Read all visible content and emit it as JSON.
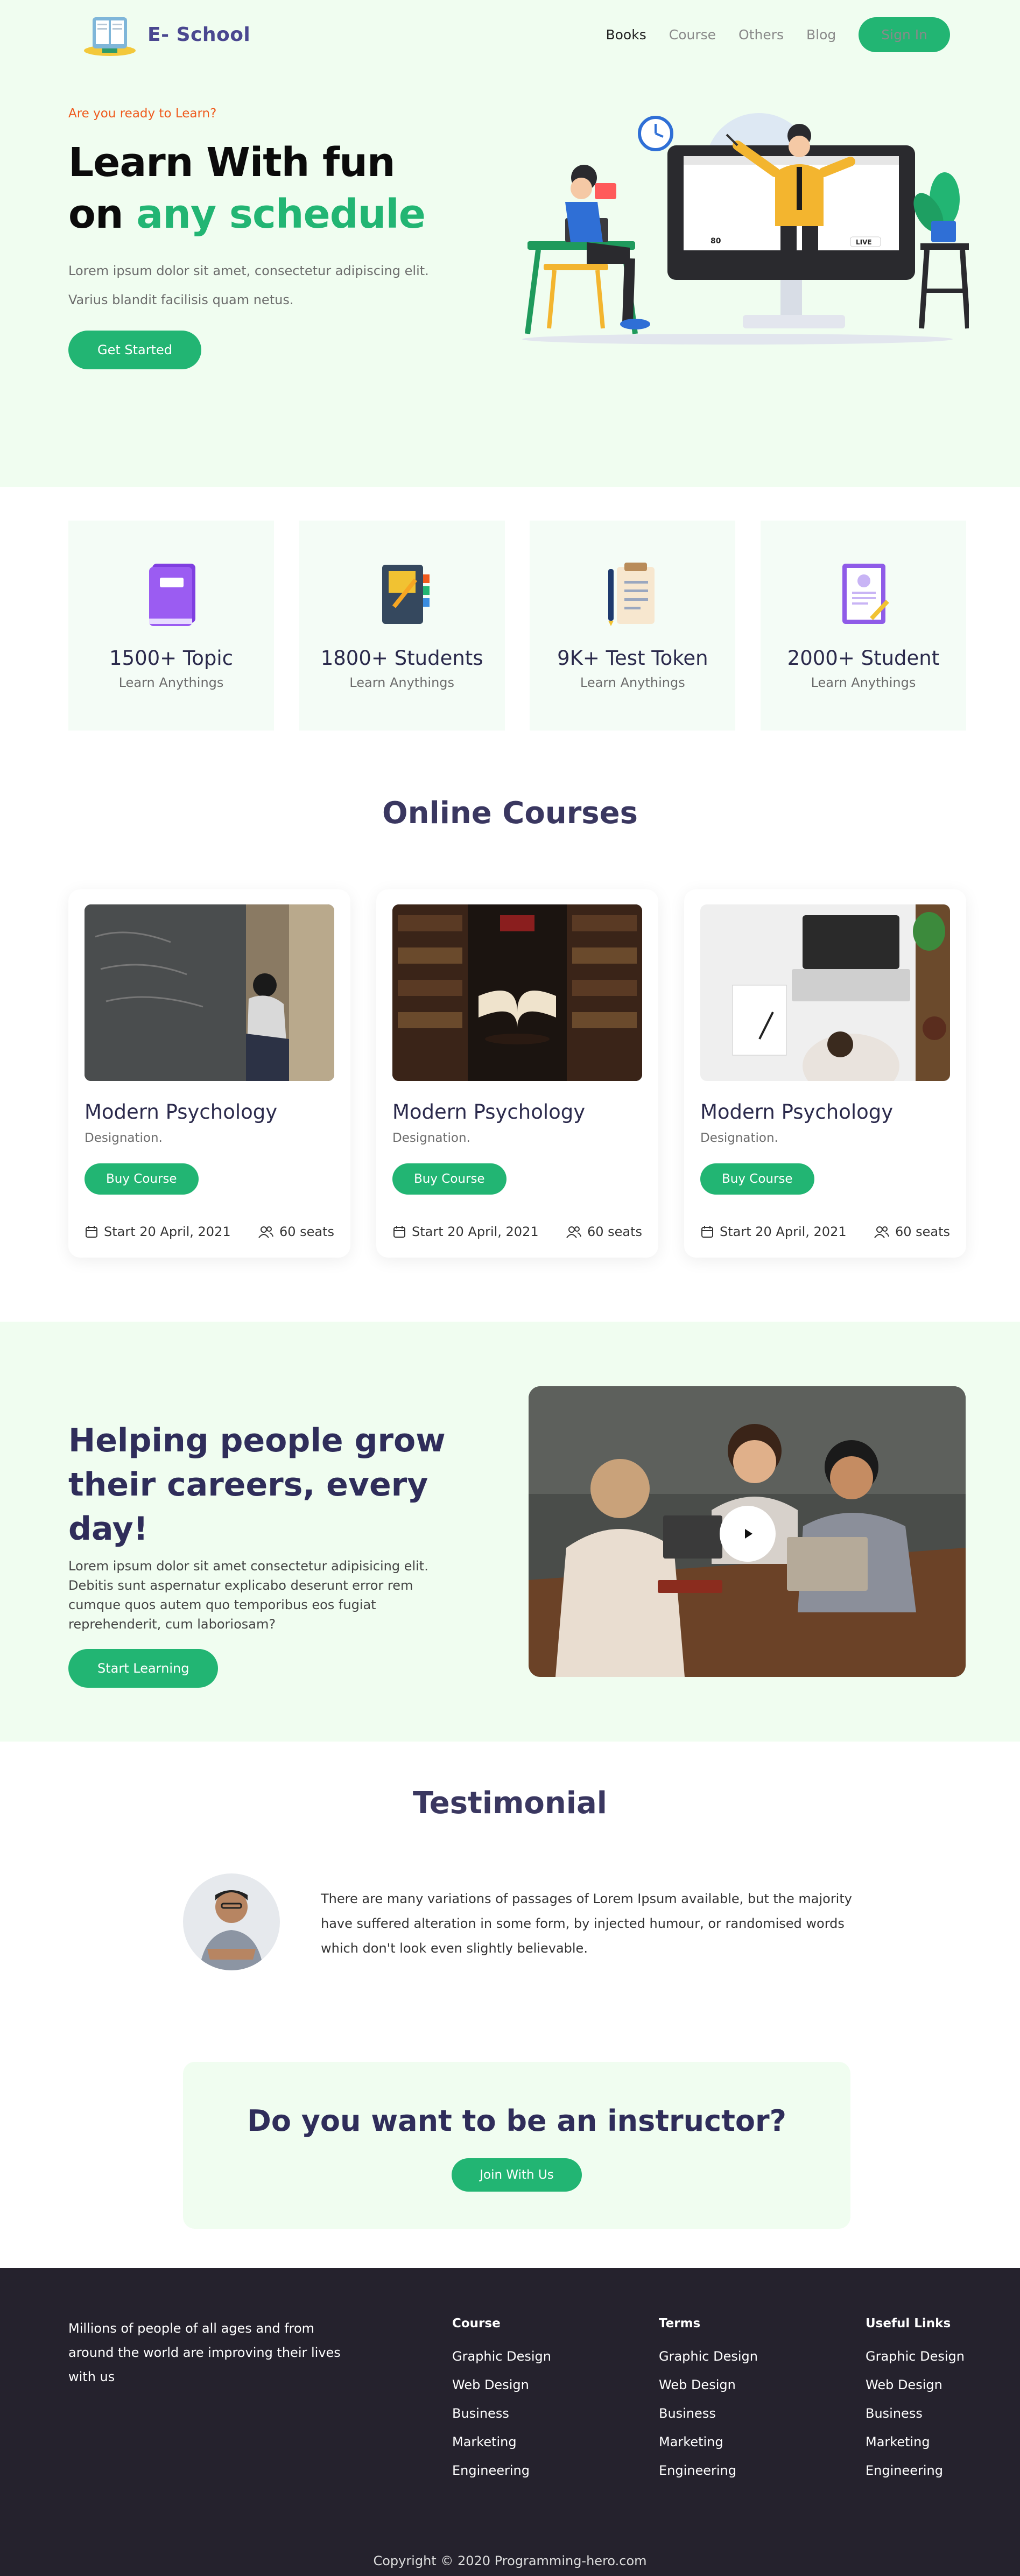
{
  "brand": {
    "name": "E- School"
  },
  "nav": {
    "items": [
      {
        "label": "Books",
        "active": true
      },
      {
        "label": "Course",
        "active": false
      },
      {
        "label": "Others",
        "active": false
      },
      {
        "label": "Blog",
        "active": false
      }
    ],
    "signin_label": "Sign In"
  },
  "hero": {
    "eyebrow": "Are you ready to Learn?",
    "title_line1": "Learn With fun",
    "title_line2_prefix": "on ",
    "title_line2_highlight": "any schedule",
    "subtitle_line1": "Lorem ipsum dolor sit amet, consectetur adipiscing elit.",
    "subtitle_line2": "Varius blandit facilisis quam netus.",
    "cta_label": "Get Started",
    "illustration_labels": {
      "count": "80",
      "live": "LIVE"
    }
  },
  "stats": [
    {
      "value": "1500+ Topic",
      "label": "Learn Anythings",
      "icon": "book-icon"
    },
    {
      "value": "1800+ Students",
      "label": "Learn Anythings",
      "icon": "notebook-pencil-icon"
    },
    {
      "value": "9K+ Test Token",
      "label": "Learn Anythings",
      "icon": "clipboard-icon"
    },
    {
      "value": "2000+ Student",
      "label": "Learn Anythings",
      "icon": "certificate-icon"
    }
  ],
  "courses": {
    "title": "Online Courses",
    "items": [
      {
        "title": "Modern Psychology",
        "designation": "Designation.",
        "button": "Buy Course",
        "start": "Start 20 April, 2021",
        "seats": "60 seats",
        "image": "blackboard-photo"
      },
      {
        "title": "Modern Psychology",
        "designation": "Designation.",
        "button": "Buy Course",
        "start": "Start 20 April, 2021",
        "seats": "60 seats",
        "image": "library-book-photo"
      },
      {
        "title": "Modern Psychology",
        "designation": "Designation.",
        "button": "Buy Course",
        "start": "Start 20 April, 2021",
        "seats": "60 seats",
        "image": "laptop-desk-photo"
      }
    ]
  },
  "career": {
    "title_line1": "Helping people grow",
    "title_line2": "their careers, every day!",
    "text": "Lorem ipsum dolor sit amet consectetur adipisicing elit. Debitis sunt aspernatur explicabo deserunt error rem cumque quos autem quo temporibus eos fugiat reprehenderit, cum laboriosam?",
    "cta_label": "Start Learning"
  },
  "testimonial": {
    "title": "Testimonial",
    "text": "There are many variations of passages of Lorem Ipsum available, but the majority have suffered alteration in some form, by injected humour, or randomised words which don't look even slightly believable."
  },
  "instructor": {
    "title": "Do you want to be an instructor?",
    "cta_label": "Join With Us"
  },
  "footer": {
    "about": "Millions of people of all ages and from around the world are improving their lives with us",
    "columns": [
      {
        "title": "Course",
        "links": [
          "Graphic Design",
          "Web Design",
          "Business",
          "Marketing",
          "Engineering"
        ]
      },
      {
        "title": "Terms",
        "links": [
          "Graphic Design",
          "Web Design",
          "Business",
          "Marketing",
          "Engineering"
        ]
      },
      {
        "title": "Useful Links",
        "links": [
          "Graphic Design",
          "Web Design",
          "Business",
          "Marketing",
          "Engineering"
        ]
      }
    ],
    "copyright": "Copyright © 2020 Programming-hero.com"
  },
  "colors": {
    "accent": "#22b573",
    "heading": "#2b2a4c",
    "eyebrow": "#ef5a1d",
    "hero_bg": "#f0fdf0",
    "footer_bg": "#25222d"
  }
}
